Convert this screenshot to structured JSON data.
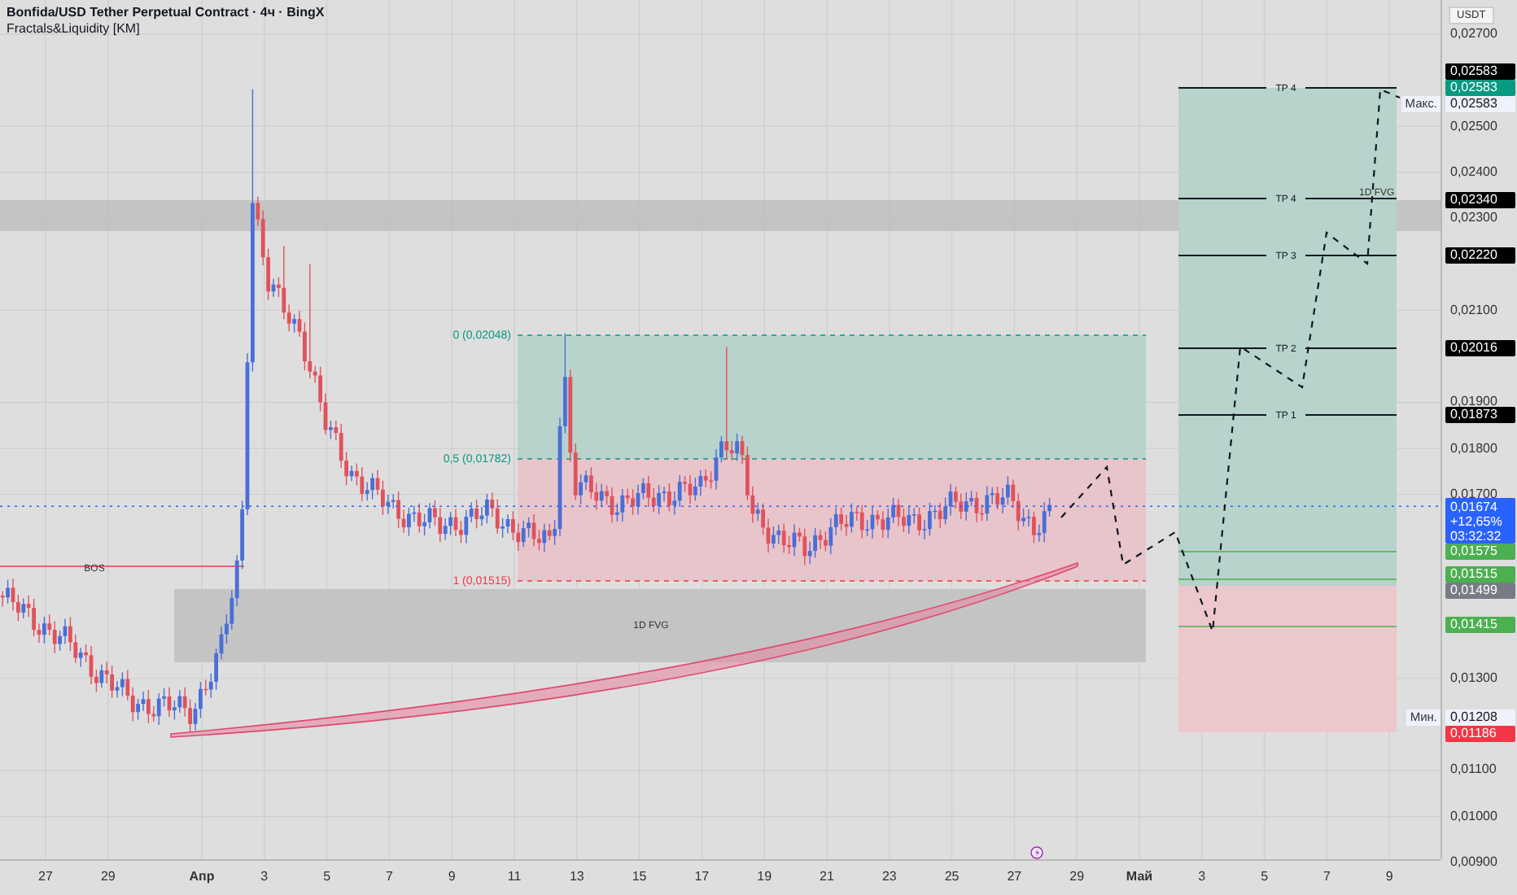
{
  "header": {
    "title": "Bonfida/USD Tether Perpetual Contract · 4ч · BingX",
    "indicator": "Fractals&Liquidity [KM]"
  },
  "chart": {
    "bos_label": "BOS",
    "fvg_labels": [
      "1D FVG",
      "1D FVG"
    ],
    "fib_levels": [
      {
        "label": "0 (0,02048)",
        "color": "#089981"
      },
      {
        "label": "0,5 (0,01782)",
        "color": "#089981"
      },
      {
        "label": "1 (0,01515)",
        "color": "#f23645"
      }
    ],
    "targets": [
      "TP 4",
      "TP 4",
      "TP 3",
      "TP 2",
      "TP 1"
    ]
  },
  "price_axis": {
    "currency": "USDT",
    "ticks": [
      "0,02700",
      "0,02500",
      "0,02400",
      "0,02300",
      "0,02100",
      "0,01900",
      "0,01800",
      "0,01700",
      "0,01300",
      "0,01100",
      "0,01000",
      "0,00900"
    ],
    "badges": [
      {
        "kind": "price",
        "text": "0,02583",
        "color": "#000000"
      },
      {
        "kind": "price",
        "text": "0,02583",
        "color": "#089981"
      },
      {
        "kind": "range",
        "text": "0,02583",
        "tag": "Макс.",
        "color": "#eef2fa"
      },
      {
        "kind": "price",
        "text": "0,02340",
        "color": "#000000"
      },
      {
        "kind": "price",
        "text": "0,02220",
        "color": "#000000"
      },
      {
        "kind": "price",
        "text": "0,02016",
        "color": "#000000"
      },
      {
        "kind": "price",
        "text": "0,01873",
        "color": "#000000"
      },
      {
        "kind": "current",
        "text": "0,01674",
        "change": "+12,65%",
        "countdown": "03:32:32",
        "color": "#2962ff"
      },
      {
        "kind": "price",
        "text": "0,01575",
        "color": "#4caf50"
      },
      {
        "kind": "price",
        "text": "0,01515",
        "color": "#4caf50"
      },
      {
        "kind": "price",
        "text": "0,01499",
        "color": "#787b86"
      },
      {
        "kind": "price",
        "text": "0,01415",
        "color": "#4caf50"
      },
      {
        "kind": "range",
        "text": "0,01208",
        "tag": "Мин.",
        "color": "#eef2fa"
      },
      {
        "kind": "price",
        "text": "0,01186",
        "color": "#f23645"
      }
    ]
  },
  "time_axis": {
    "labels": [
      "27",
      "29",
      "Апр",
      "3",
      "5",
      "7",
      "9",
      "11",
      "13",
      "15",
      "17",
      "19",
      "21",
      "23",
      "25",
      "27",
      "29",
      "Май",
      "3",
      "5",
      "7",
      "9"
    ]
  }
}
